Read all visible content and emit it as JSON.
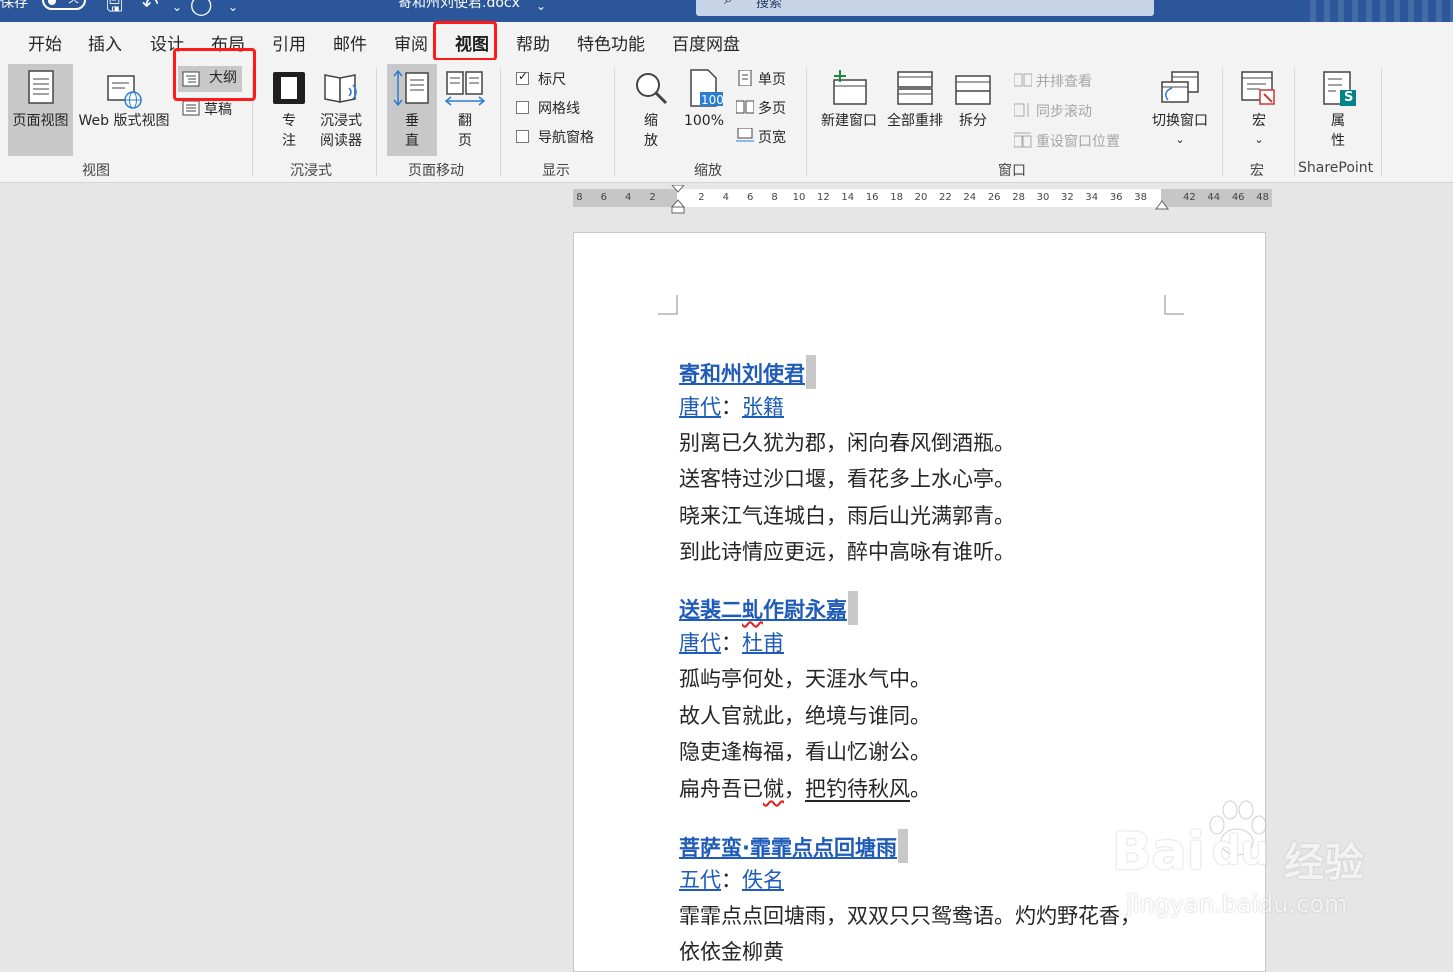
{
  "titlebar": {
    "autosave_label": "保存",
    "autosave_state": "关",
    "document_title": "寄和州刘使君.docx",
    "search_placeholder": "搜索"
  },
  "tabs": [
    {
      "label": "开始",
      "active": false
    },
    {
      "label": "插入",
      "active": false
    },
    {
      "label": "设计",
      "active": false
    },
    {
      "label": "布局",
      "active": false
    },
    {
      "label": "引用",
      "active": false
    },
    {
      "label": "邮件",
      "active": false
    },
    {
      "label": "审阅",
      "active": false
    },
    {
      "label": "视图",
      "active": true
    },
    {
      "label": "帮助",
      "active": false
    },
    {
      "label": "特色功能",
      "active": false
    },
    {
      "label": "百度网盘",
      "active": false
    }
  ],
  "ribbon": {
    "views": {
      "group_label": "视图",
      "print_layout": "页面视图",
      "web_layout": "Web 版式视图",
      "outline": "大纲",
      "draft": "草稿"
    },
    "immersive": {
      "group_label": "沉浸式",
      "focus": "专注",
      "immersive_reader_1": "沉浸式",
      "immersive_reader_2": "阅读器"
    },
    "page_movement": {
      "group_label": "页面移动",
      "vertical": "垂直",
      "side_to_side": "翻页"
    },
    "show": {
      "group_label": "显示",
      "ruler": "标尺",
      "ruler_checked": true,
      "gridlines": "网格线",
      "gridlines_checked": false,
      "navigation_pane": "导航窗格",
      "navigation_pane_checked": false
    },
    "zoom": {
      "group_label": "缩放",
      "zoom": "缩放",
      "hundred": "100%",
      "hundred_icon_text": "100",
      "one_page": "单页",
      "multiple_pages": "多页",
      "page_width": "页宽"
    },
    "window": {
      "group_label": "窗口",
      "new_window": "新建窗口",
      "arrange_all": "全部重排",
      "split": "拆分",
      "view_side_by_side": "并排查看",
      "synchronous_scrolling": "同步滚动",
      "reset_window_position": "重设窗口位置",
      "switch_windows": "切换窗口"
    },
    "macros": {
      "group_label": "宏",
      "macros": "宏"
    },
    "sharepoint": {
      "group_label": "SharePoint",
      "properties": "属性"
    }
  },
  "ruler": {
    "left_numbers": [
      "8",
      "6",
      "4",
      "2"
    ],
    "numbers": [
      "2",
      "4",
      "6",
      "8",
      "10",
      "12",
      "14",
      "16",
      "18",
      "20",
      "22",
      "24",
      "26",
      "28",
      "30",
      "32",
      "34",
      "36",
      "38"
    ],
    "right_numbers": [
      "42",
      "44",
      "46",
      "48"
    ]
  },
  "document": {
    "poems": [
      {
        "title": "寄和州刘使君",
        "dynasty": "唐代",
        "author": "张籍",
        "lines": [
          "别离已久犹为郡，闲向春风倒酒瓶。",
          "送客特过沙口堰，看花多上水心亭。",
          "晓来江气连城白，雨后山光满郭青。",
          "到此诗情应更远，醉中高咏有谁听。"
        ]
      },
      {
        "title_pre": "送裴二",
        "title_squiggle": "虬",
        "title_post": "作尉永嘉",
        "dynasty": "唐代",
        "author": "杜甫",
        "lines": [
          "孤屿亭何处，天涯水气中。",
          "故人官就此，绝境与谁同。",
          "隐吏逢梅福，看山忆谢公。"
        ],
        "last_line_a": "扁舟吾已",
        "last_line_squiggle": "僦",
        "last_line_b": "，",
        "last_line_link": "把钓待秋风",
        "last_line_c": "。"
      },
      {
        "title": "菩萨蛮·霏霏点点回塘雨",
        "dynasty": "五代",
        "author": "佚名",
        "lines": [
          "霏霏点点回塘雨，双双只只鸳鸯语。灼灼野花香，",
          "依依金柳黄"
        ]
      }
    ],
    "author_sep": "："
  },
  "watermark": {
    "brand": "Bai",
    "brand2": "du",
    "brand_cn": "经验",
    "url": "jingyan.baidu.com"
  }
}
